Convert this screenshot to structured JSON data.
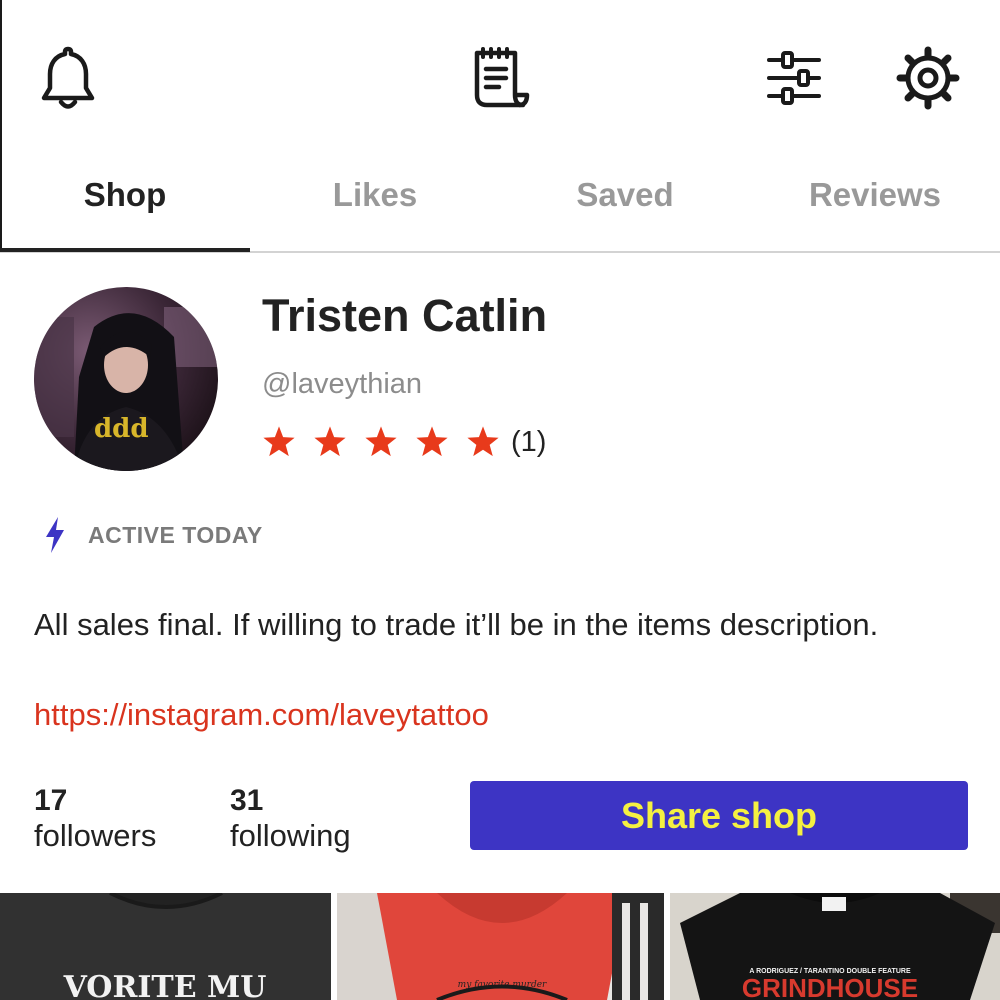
{
  "top_icons": [
    "bell-icon",
    "receipt-icon",
    "sliders-icon",
    "gear-icon"
  ],
  "tabs": [
    {
      "label": "Shop",
      "active": true
    },
    {
      "label": "Likes",
      "active": false
    },
    {
      "label": "Saved",
      "active": false
    },
    {
      "label": "Reviews",
      "active": false
    }
  ],
  "profile": {
    "name": "Tristen Catlin",
    "handle": "@laveythian",
    "rating_stars": 5,
    "rating_count": "(1)",
    "activity": "ACTIVE TODAY",
    "bio": "All sales final. If willing to trade it’ll be in the items description.",
    "link": "https://instagram.com/laveytattoo"
  },
  "stats": {
    "followers_count": "17",
    "followers_label": "followers",
    "following_count": "31",
    "following_label": "following"
  },
  "share_button": "Share shop",
  "thumbnails": {
    "shirt1_text": "VORITE MU",
    "shirt2_text": "my favorite murder",
    "shirt3_top_text": "A RODRIGUEZ / TARANTINO DOUBLE FEATURE",
    "shirt3_title": "GRINDHOUSE"
  },
  "colors": {
    "accent_button": "#3d34c4",
    "button_text": "#f5f041",
    "star": "#e83a1b",
    "link": "#d9341e",
    "bolt": "#3d34c4"
  }
}
